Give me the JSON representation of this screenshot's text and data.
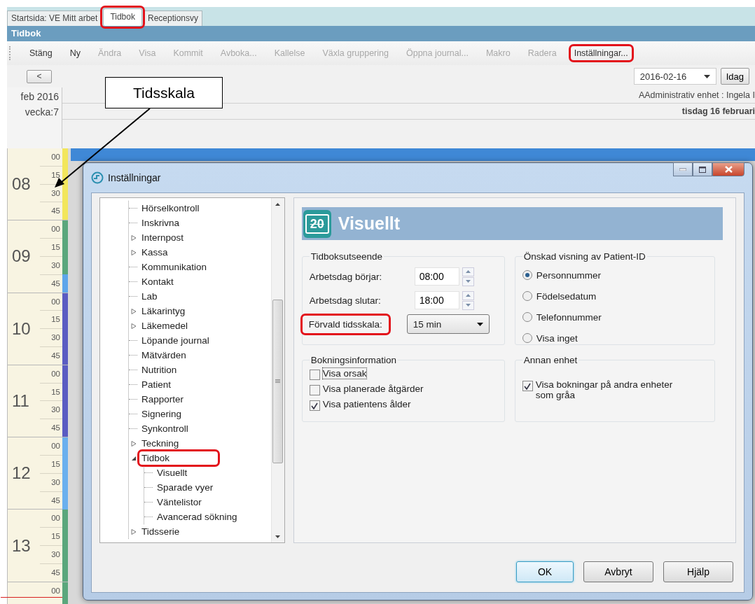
{
  "tabs": [
    {
      "label": "Startsida: VE Mitt arbet",
      "selected": false,
      "highlighted": false
    },
    {
      "label": "Tidbok",
      "selected": true,
      "highlighted": true
    },
    {
      "label": "Receptionsvy",
      "selected": false,
      "highlighted": false
    }
  ],
  "panel_title": "Tidbok",
  "toolbar": [
    {
      "label": "Stäng",
      "disabled": false,
      "highlighted": false
    },
    {
      "label": "Ny",
      "disabled": false,
      "highlighted": false
    },
    {
      "label": "Ändra",
      "disabled": true,
      "highlighted": false
    },
    {
      "label": "Visa",
      "disabled": true,
      "highlighted": false
    },
    {
      "label": "Kommit",
      "disabled": true,
      "highlighted": false
    },
    {
      "label": "Avboka...",
      "disabled": true,
      "highlighted": false
    },
    {
      "label": "Kallelse",
      "disabled": true,
      "highlighted": false
    },
    {
      "label": "Växla gruppering",
      "disabled": true,
      "highlighted": false
    },
    {
      "label": "Öppna journal...",
      "disabled": true,
      "highlighted": false
    },
    {
      "label": "Makro",
      "disabled": true,
      "highlighted": false
    },
    {
      "label": "Radera",
      "disabled": true,
      "highlighted": false
    },
    {
      "label": "Inställningar...",
      "disabled": false,
      "highlighted": true
    }
  ],
  "nav": {
    "prev_button": "<",
    "date": "2016-02-16",
    "today_button": "Idag"
  },
  "header": {
    "month": "feb 2016",
    "week": "vecka:7",
    "unit": "AAdministrativ enhet : Ingela I",
    "day": "tisdag 16 februari"
  },
  "timescale": {
    "hours": [
      {
        "hour": "08",
        "slots": [
          {
            "minute": "00",
            "color": "#f2e65c"
          },
          {
            "minute": "15",
            "color": "#f2e65c"
          },
          {
            "minute": "30",
            "color": "#f2e65c"
          },
          {
            "minute": "45",
            "color": "#f2e65c"
          }
        ]
      },
      {
        "hour": "09",
        "slots": [
          {
            "minute": "00",
            "color": "#5aa77c"
          },
          {
            "minute": "15",
            "color": "#5aa77c"
          },
          {
            "minute": "30",
            "color": "#5aa77c"
          },
          {
            "minute": "45",
            "color": "#5ea6ea"
          }
        ]
      },
      {
        "hour": "10",
        "slots": [
          {
            "minute": "00",
            "color": "#5a5cc2"
          },
          {
            "minute": "15",
            "color": "#5a5cc2"
          },
          {
            "minute": "30",
            "color": "#5a5cc2"
          },
          {
            "minute": "45",
            "color": "#5a5cc2"
          }
        ]
      },
      {
        "hour": "11",
        "slots": [
          {
            "minute": "00",
            "color": "#5a5cc2"
          },
          {
            "minute": "15",
            "color": "#5a5cc2"
          },
          {
            "minute": "30",
            "color": "#5a5cc2"
          },
          {
            "minute": "45",
            "color": "#5a5cc2"
          }
        ]
      },
      {
        "hour": "12",
        "slots": [
          {
            "minute": "00",
            "color": "#6ab0ee"
          },
          {
            "minute": "15",
            "color": "#6ab0ee"
          },
          {
            "minute": "30",
            "color": "#6ab0ee"
          },
          {
            "minute": "45",
            "color": "#6ab0ee"
          }
        ]
      },
      {
        "hour": "13",
        "slots": [
          {
            "minute": "00",
            "color": "#5aa77c"
          },
          {
            "minute": "15",
            "color": "#5aa77c"
          },
          {
            "minute": "30",
            "color": "#5aa77c"
          },
          {
            "minute": "45",
            "color": "#5aa77c"
          }
        ]
      }
    ],
    "next_slot": {
      "minute": "00",
      "color": "#5aa77c",
      "current_time": true
    }
  },
  "callout": {
    "label": "Tidsskala"
  },
  "dialog": {
    "title": "Inställningar",
    "tree": [
      {
        "label": "Hörselkontroll",
        "kind": "leaf",
        "highlighted": false
      },
      {
        "label": "Inskrivna",
        "kind": "leaf",
        "highlighted": false
      },
      {
        "label": "Internpost",
        "kind": "node",
        "expanded": false,
        "highlighted": false
      },
      {
        "label": "Kassa",
        "kind": "node",
        "expanded": false,
        "highlighted": false
      },
      {
        "label": "Kommunikation",
        "kind": "leaf",
        "highlighted": false
      },
      {
        "label": "Kontakt",
        "kind": "leaf",
        "highlighted": false
      },
      {
        "label": "Lab",
        "kind": "leaf",
        "highlighted": false
      },
      {
        "label": "Läkarintyg",
        "kind": "node",
        "expanded": false,
        "highlighted": false
      },
      {
        "label": "Läkemedel",
        "kind": "node",
        "expanded": false,
        "highlighted": false
      },
      {
        "label": "Löpande journal",
        "kind": "leaf",
        "highlighted": false
      },
      {
        "label": "Mätvärden",
        "kind": "leaf",
        "highlighted": false
      },
      {
        "label": "Nutrition",
        "kind": "leaf",
        "highlighted": false
      },
      {
        "label": "Patient",
        "kind": "leaf",
        "highlighted": false
      },
      {
        "label": "Rapporter",
        "kind": "leaf",
        "highlighted": false
      },
      {
        "label": "Signering",
        "kind": "leaf",
        "highlighted": false
      },
      {
        "label": "Synkontroll",
        "kind": "leaf",
        "highlighted": false
      },
      {
        "label": "Teckning",
        "kind": "node",
        "expanded": false,
        "highlighted": false
      },
      {
        "label": "Tidbok",
        "kind": "node",
        "expanded": true,
        "highlighted": true,
        "children": [
          {
            "label": "Visuellt",
            "kind": "leaf",
            "highlighted": false
          },
          {
            "label": "Sparade vyer",
            "kind": "leaf",
            "highlighted": false
          },
          {
            "label": "Väntelistor",
            "kind": "leaf",
            "highlighted": false
          },
          {
            "label": "Avancerad sökning",
            "kind": "leaf",
            "highlighted": false
          }
        ]
      },
      {
        "label": "Tidsserie",
        "kind": "node",
        "expanded": false,
        "highlighted": false
      }
    ],
    "page": {
      "icon_label": "20",
      "title": "Visuellt",
      "appearance": {
        "legend": "Tidboksutseende",
        "fields": [
          {
            "kind": "spinner",
            "label": "Arbetsdag börjar:",
            "value": "08:00",
            "highlighted": false
          },
          {
            "kind": "spinner",
            "label": "Arbetsdag slutar:",
            "value": "18:00",
            "highlighted": false
          },
          {
            "kind": "dropdown",
            "label": "Förvald tidsskala:",
            "value": "15 min",
            "highlighted": true
          }
        ]
      },
      "patient_id": {
        "legend": "Önskad visning av Patient-ID",
        "options": [
          {
            "label": "Personnummer",
            "selected": true
          },
          {
            "label": "Födelsedatum",
            "selected": false
          },
          {
            "label": "Telefonnummer",
            "selected": false
          },
          {
            "label": "Visa inget",
            "selected": false
          }
        ]
      },
      "booking_info": {
        "legend": "Bokningsinformation",
        "options": [
          {
            "label": "Visa orsak",
            "checked": false,
            "focused": true
          },
          {
            "label": "Visa planerade åtgärder",
            "checked": false,
            "focused": false
          },
          {
            "label": "Visa patientens ålder",
            "checked": true,
            "focused": false
          }
        ]
      },
      "other_unit": {
        "legend": "Annan enhet",
        "options": [
          {
            "label": "Visa bokningar på andra enheter som gråa",
            "checked": true,
            "focused": false
          }
        ]
      }
    },
    "buttons": [
      {
        "label": "OK",
        "default": true
      },
      {
        "label": "Avbryt",
        "default": false
      },
      {
        "label": "Hjälp",
        "default": false
      }
    ]
  }
}
